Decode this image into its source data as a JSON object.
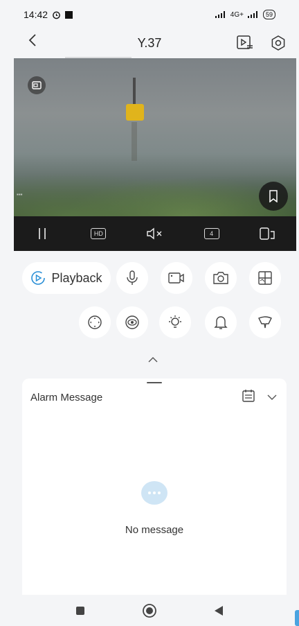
{
  "status_bar": {
    "time": "14:42",
    "network": "4G+",
    "battery": "59"
  },
  "header": {
    "title": "Y.37"
  },
  "controls": {
    "playback_label": "Playback",
    "quality_label": "HD",
    "split_count": "4"
  },
  "alarm": {
    "title": "Alarm Message",
    "empty_text": "No message"
  },
  "colors": {
    "accent": "#2a8fd6",
    "empty_icon_bg": "#cfe5f5",
    "control_bar_bg": "#1b1b1b"
  },
  "icons": [
    "alarm-clock-icon",
    "back-arrow-icon",
    "playlist-icon",
    "settings-icon",
    "fullscreen-icon",
    "bookmark-icon",
    "pause-icon",
    "hd-icon",
    "mute-icon",
    "split-screen-icon",
    "rotate-screen-icon",
    "playback-icon",
    "microphone-icon",
    "record-video-icon",
    "camera-icon",
    "multi-view-icon",
    "ptz-icon",
    "eye-icon",
    "light-icon",
    "bell-icon",
    "sound-icon",
    "chevron-up-icon",
    "calendar-icon",
    "chevron-down-icon",
    "chat-icon",
    "nav-recents-icon",
    "nav-home-icon",
    "nav-back-icon"
  ]
}
